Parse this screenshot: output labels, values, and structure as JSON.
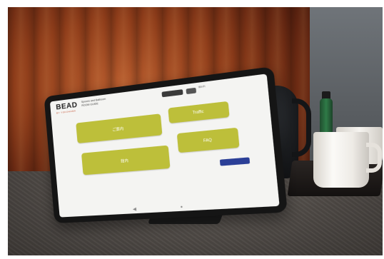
{
  "device": {
    "brand_logo": "BEAD",
    "brand_tagline": "BY YOKOHAMA",
    "hotel_name": "Spoons and Ballroom",
    "hotel_subtitle": "ROOM GUIDE",
    "wifi_label": "Wi-Fi",
    "tiles": [
      {
        "label": "ご案内"
      },
      {
        "label": "Traffic"
      },
      {
        "label": "館内"
      },
      {
        "label": "FAQ"
      }
    ],
    "cta_label": "Contact",
    "nav": {
      "back_glyph": "◀",
      "home_glyph": "●"
    }
  },
  "scene": {
    "objects": [
      "tablet-on-stand",
      "electric-kettle",
      "white-cups",
      "tray",
      "spray-bottle",
      "curtain",
      "desk"
    ]
  },
  "colors": {
    "tile": "#bdbf3a",
    "cta": "#2b3f97",
    "curtain": "#8f3d1a"
  }
}
